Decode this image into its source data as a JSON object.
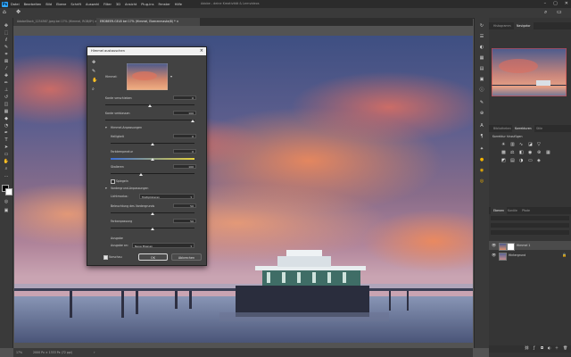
{
  "menubar": {
    "logo": "Ps",
    "items": [
      "Datei",
      "Bearbeiten",
      "Bild",
      "Ebene",
      "Schrift",
      "Auswahl",
      "Filter",
      "3D",
      "Ansicht",
      "Plug-ins",
      "Fenster",
      "Hilfe"
    ],
    "center_text": "Adobe - deine Kreativität & Lernvideos"
  },
  "tabs": [
    {
      "label": "AdobeStock_1234567.jpeg bei 17% (Himmel, RGB/8*) ×",
      "active": false
    },
    {
      "label": "ERDBEER-GELB bei 17% (Himmel, Ebenenmaske/8) * ×",
      "active": true
    }
  ],
  "dialog": {
    "title": "Himmel austauschen",
    "close": "×",
    "sky_label": "Himmel:",
    "fields": {
      "edge_shift_label": "Kante verschieben",
      "edge_shift_value": "0",
      "fade_edge_label": "Kante verblassen",
      "fade_edge_value": "100",
      "sky_adjust_label": "Himmel-Anpassungen",
      "brightness_label": "Helligkeit",
      "brightness_value": "0",
      "temperature_label": "Farbtemperatur",
      "temperature_value": "0",
      "scale_label": "Skalieren",
      "scale_value": "100",
      "flip_label": "Spiegeln",
      "fg_adjust_label": "Vordergrund-Anpassungen",
      "light_mode_label": "Lichtmodus:",
      "light_mode_value": "Multiplizieren",
      "fg_light_label": "Beleuchtung des Vordergrunds",
      "fg_light_value": "50",
      "color_adjust_label": "Farbanpassung",
      "color_adjust_value": "50",
      "output_label": "Ausgabe",
      "output_to_label": "Ausgabe an:",
      "output_to_value": "Neue Ebenen",
      "preview_label": "Vorschau",
      "ok_label": "OK",
      "cancel_label": "Abbrechen"
    }
  },
  "panels": {
    "top_tabs": [
      "Histogramm",
      "Navigator"
    ],
    "mid_tabs": [
      "Bibliotheken",
      "Korrekturen",
      "Stile"
    ],
    "corrections_hint": "Korrektur hinzufügen",
    "layers_tabs": [
      "Ebenen",
      "Kanäle",
      "Pfade"
    ],
    "layers": [
      {
        "name": "Himmel 1",
        "active": true
      },
      {
        "name": "Hintergrund",
        "active": false
      }
    ]
  },
  "statusbar": {
    "zoom": "17%",
    "info": "2000 Px × 1333 Px (72 ppi)"
  },
  "colors": {
    "accent": "#31a8ff",
    "chrome_dark": "#2b2b2b",
    "chrome": "#3a3a3a",
    "dialog_bg": "#424242"
  }
}
